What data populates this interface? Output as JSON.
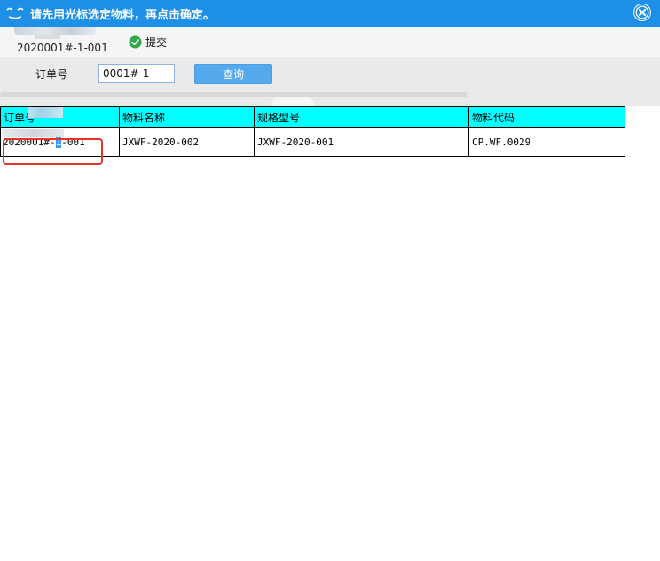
{
  "titlebar": {
    "title": "请先用光标选定物料，再点击确定。",
    "close_icon": "close-icon"
  },
  "toolbar": {
    "user_code": "2020001#-1-001",
    "submit_label": "提交",
    "submit_icon": "check-circle-icon"
  },
  "search": {
    "order_label": "订单号",
    "order_value": "0001#-1",
    "query_label": "查询"
  },
  "table": {
    "headers": [
      "订单号",
      "物料名称",
      "规格型号",
      "物料代码"
    ],
    "rows": [
      {
        "order_prefix": "2020001#-",
        "order_selected": "1",
        "order_suffix": "-001",
        "material_name": "JXWF-2020-002",
        "spec": "JXWF-2020-001",
        "material_code": "CP.WF.0029"
      }
    ]
  },
  "colors": {
    "titlebar": "#1e8fe6",
    "header_bg": "#00ffff",
    "query_button": "#54aaec",
    "highlight": "#e3342a"
  }
}
